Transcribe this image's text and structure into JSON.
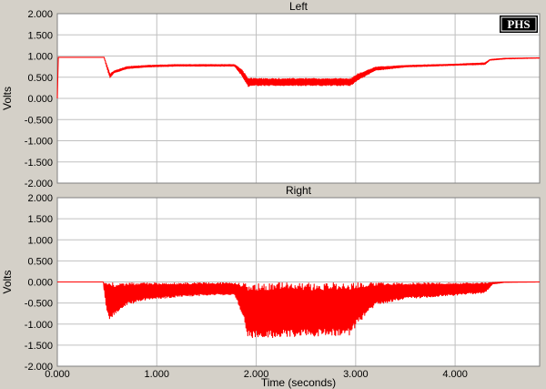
{
  "colors": {
    "background": "#d4d0c8",
    "plot": "#ffffff",
    "grid": "#c0c0c0",
    "trace": "#ff0000"
  },
  "logo": {
    "text": "PHS"
  },
  "chart_data": [
    {
      "type": "line",
      "title": "Left",
      "xlabel": "",
      "ylabel": "Volts",
      "xlim": [
        0,
        4.85
      ],
      "ylim": [
        -2,
        2
      ],
      "grid": true,
      "x_ticks": [
        "0.000",
        "1.000",
        "2.000",
        "3.000",
        "4.000"
      ],
      "y_ticks": [
        "2.000",
        "1.500",
        "1.000",
        "0.500",
        "0.000",
        "-0.500",
        "-1.000",
        "-1.500",
        "-2.000"
      ],
      "series": [
        {
          "envelope": true,
          "x": [
            0.0,
            0.01,
            0.47,
            0.5,
            0.53,
            0.57,
            0.7,
            0.9,
            1.2,
            1.5,
            1.78,
            1.85,
            1.92,
            2.0,
            2.5,
            2.95,
            3.02,
            3.2,
            3.5,
            4.0,
            4.3,
            4.35,
            4.5,
            4.85
          ],
          "upper": [
            0.0,
            0.97,
            0.97,
            0.78,
            0.58,
            0.65,
            0.75,
            0.78,
            0.8,
            0.8,
            0.8,
            0.7,
            0.48,
            0.47,
            0.47,
            0.47,
            0.58,
            0.74,
            0.78,
            0.81,
            0.84,
            0.92,
            0.95,
            0.96
          ],
          "lower": [
            0.0,
            0.97,
            0.97,
            0.7,
            0.48,
            0.6,
            0.7,
            0.74,
            0.76,
            0.76,
            0.76,
            0.55,
            0.28,
            0.3,
            0.3,
            0.3,
            0.42,
            0.66,
            0.74,
            0.78,
            0.8,
            0.9,
            0.93,
            0.95
          ]
        }
      ]
    },
    {
      "type": "line",
      "title": "Right",
      "xlabel": "Time (seconds)",
      "ylabel": "Volts",
      "xlim": [
        0,
        4.85
      ],
      "ylim": [
        -2,
        2
      ],
      "grid": true,
      "x_ticks": [
        "0.000",
        "1.000",
        "2.000",
        "3.000",
        "4.000"
      ],
      "y_ticks": [
        "2.000",
        "1.500",
        "1.000",
        "0.500",
        "0.000",
        "-0.500",
        "-1.000",
        "-1.500",
        "-2.000"
      ],
      "series": [
        {
          "envelope": true,
          "x": [
            0.0,
            0.46,
            0.48,
            0.5,
            0.53,
            0.57,
            0.7,
            0.9,
            1.2,
            1.5,
            1.78,
            1.85,
            1.92,
            2.0,
            2.5,
            2.95,
            3.0,
            3.2,
            3.5,
            4.0,
            4.3,
            4.38,
            4.5,
            4.85
          ],
          "upper": [
            0.0,
            0.0,
            -0.02,
            -0.02,
            -0.02,
            -0.02,
            -0.02,
            -0.02,
            -0.02,
            -0.02,
            -0.02,
            -0.02,
            -0.02,
            -0.02,
            -0.02,
            -0.02,
            -0.02,
            -0.02,
            -0.02,
            -0.02,
            -0.02,
            -0.01,
            0.0,
            0.0
          ],
          "lower": [
            0.0,
            0.0,
            -0.4,
            -0.75,
            -0.92,
            -0.8,
            -0.55,
            -0.42,
            -0.36,
            -0.32,
            -0.3,
            -0.7,
            -1.32,
            -1.33,
            -1.3,
            -1.28,
            -1.05,
            -0.55,
            -0.4,
            -0.32,
            -0.26,
            -0.05,
            -0.01,
            0.0
          ]
        }
      ]
    }
  ]
}
